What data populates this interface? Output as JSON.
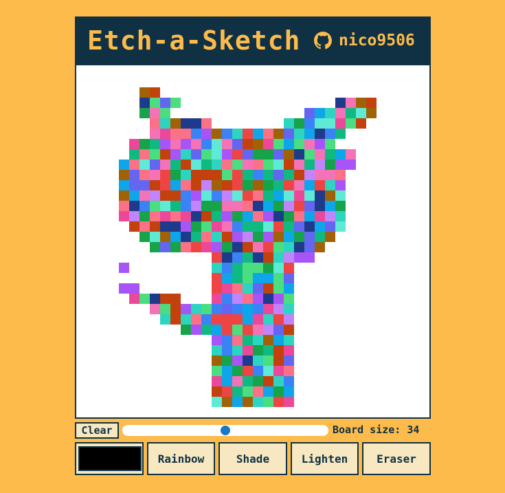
{
  "header": {
    "title": "Etch-a-Sketch",
    "github_user": "nico9506",
    "github_icon": "github-icon"
  },
  "board": {
    "size": 34,
    "palette": [
      "#5EEAD4",
      "#D946EF",
      "#EF4444",
      "#84CC16",
      "#3B82F6",
      "#F59E0B",
      "#A855F7",
      "#22C55E",
      "#EC4899",
      "#14B8A6",
      "#6366F1",
      "#F97316",
      "#10B981",
      "#8B5CF6",
      "#F472B6",
      "#65A30D",
      "#0EA5E9",
      "#B91C1C",
      "#4ADE80",
      "#7C3AED",
      "#C084FC",
      "#FACC15",
      "#2DD4BF",
      "#DB2777",
      "#1E3A8A",
      "#9CA3AF",
      "#A16207",
      "#BE185D",
      "#16A34A",
      "#60A5FA",
      "#FB7185",
      "#064E3B",
      "#C2410C",
      "#D9F99D"
    ],
    "cat_rows": [
      "...........##..................................",
      "...........###.................#####...........",
      "...........##..........................",
      "............###.......................",
      "........................................"
    ]
  },
  "controls": {
    "clear_label": "Clear",
    "board_size_label": "Board size: 34",
    "slider_value": 34,
    "slider_min": 2,
    "slider_max": 66
  },
  "tools": {
    "current_color": "#000000",
    "rainbow_label": "Rainbow",
    "shade_label": "Shade",
    "lighten_label": "Lighten",
    "eraser_label": "Eraser"
  }
}
